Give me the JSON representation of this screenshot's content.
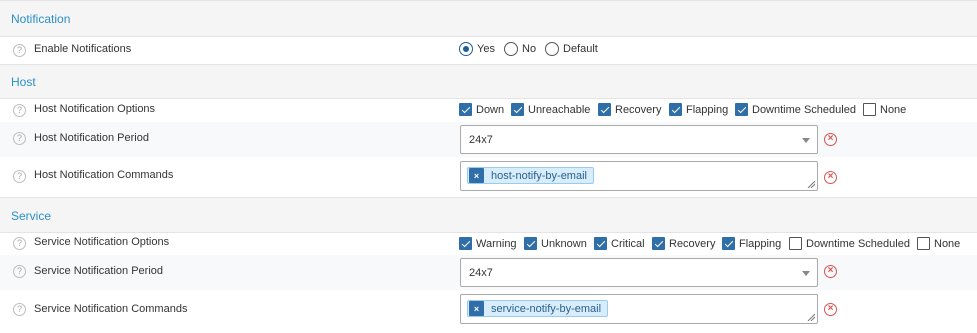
{
  "sections": {
    "notification": "Notification",
    "host": "Host",
    "service": "Service"
  },
  "help_glyph": "?",
  "enable_notifications": {
    "label": "Enable Notifications",
    "options": [
      "Yes",
      "No",
      "Default"
    ],
    "selected": "Yes"
  },
  "host": {
    "options_label": "Host Notification Options",
    "options": [
      {
        "label": "Down",
        "checked": true
      },
      {
        "label": "Unreachable",
        "checked": true
      },
      {
        "label": "Recovery",
        "checked": true
      },
      {
        "label": "Flapping",
        "checked": true
      },
      {
        "label": "Downtime Scheduled",
        "checked": true
      },
      {
        "label": "None",
        "checked": false
      }
    ],
    "period_label": "Host Notification Period",
    "period_value": "24x7",
    "commands_label": "Host Notification Commands",
    "command_tag": "host-notify-by-email",
    "tag_remove": "×"
  },
  "service": {
    "options_label": "Service Notification Options",
    "options": [
      {
        "label": "Warning",
        "checked": true
      },
      {
        "label": "Unknown",
        "checked": true
      },
      {
        "label": "Critical",
        "checked": true
      },
      {
        "label": "Recovery",
        "checked": true
      },
      {
        "label": "Flapping",
        "checked": true
      },
      {
        "label": "Downtime Scheduled",
        "checked": false
      },
      {
        "label": "None",
        "checked": false
      }
    ],
    "period_label": "Service Notification Period",
    "period_value": "24x7",
    "commands_label": "Service Notification Commands",
    "command_tag": "service-notify-by-email",
    "tag_remove": "×"
  },
  "clear_glyph": "×",
  "colors": {
    "section_title": "#2a8fc9",
    "checkbox_checked": "#2f6ea8",
    "clear_icon": "#d9534f",
    "tag_bg": "#d7edfb"
  }
}
